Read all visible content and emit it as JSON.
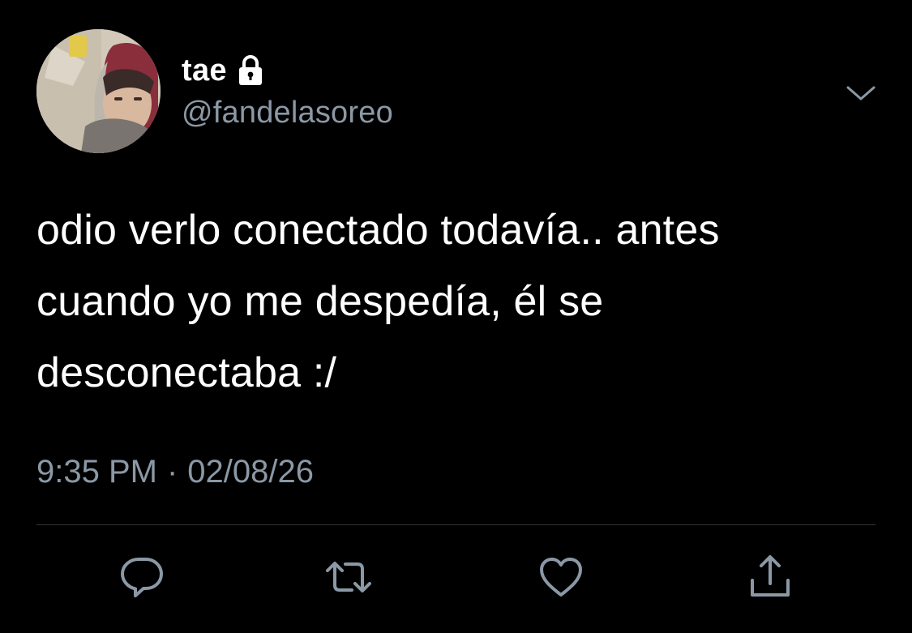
{
  "tweet": {
    "author": {
      "display_name": "tae",
      "handle": "@fandelasoreo",
      "protected_icon": "lock-icon",
      "avatar": "profile-photo"
    },
    "text": "odio verlo conectado todavía.. antes\ncuando yo me despedía, él se\ndesconectaba :/",
    "time": "9:35 PM",
    "separator": "·",
    "date": "02/08/26",
    "menu_icon": "chevron-down-icon",
    "actions": [
      {
        "name": "reply",
        "icon": "reply-icon"
      },
      {
        "name": "retweet",
        "icon": "retweet-icon"
      },
      {
        "name": "like",
        "icon": "heart-icon"
      },
      {
        "name": "share",
        "icon": "share-icon"
      }
    ]
  },
  "colors": {
    "background": "#000000",
    "primary_text": "#ffffff",
    "secondary_text": "#8b98a5",
    "divider": "#2f3336"
  }
}
